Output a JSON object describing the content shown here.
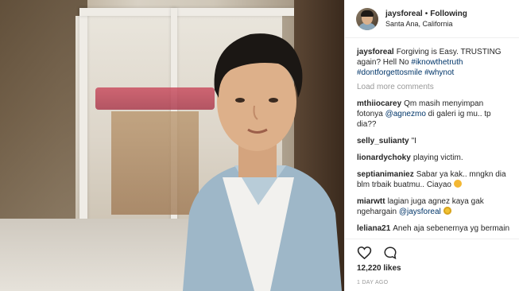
{
  "post": {
    "username": "jaysforeal",
    "separator": "•",
    "follow_status": "Following",
    "location": "Santa Ana, California"
  },
  "caption": {
    "username": "jaysforeal",
    "text": "Forgiving is Easy. TRUSTING again? Hell No",
    "hashtags": [
      "#iknowthetruth",
      "#dontforgettosmile",
      "#whynot"
    ]
  },
  "load_more": "Load more comments",
  "comments": [
    {
      "user": "mthiiocarey",
      "pre": "Qm masih menyimpan fotonya",
      "mention": "@agnezmo",
      "post": "di galeri ig mu.. tp dia??"
    },
    {
      "user": "selly_sulianty",
      "pre": "\"I",
      "mention": "",
      "post": ""
    },
    {
      "user": "lionardychoky",
      "pre": "playing victim.",
      "mention": "",
      "post": ""
    },
    {
      "user": "septianimaniez",
      "pre": "Sabar ya kak.. mngkn dia blm trbaik buatmu.. Ciayao",
      "mention": "",
      "post": ""
    },
    {
      "user": "miarwtt",
      "pre": "lagian juga agnez kaya gak ngehargain",
      "mention": "@jaysforeal",
      "post": ""
    },
    {
      "user": "leliana21",
      "pre": "Aneh aja sebenernya yg bermain api dlu adlh c cwe..... tp yg dibilang playing victim seolah2 vg cwo..... harusnva",
      "mention": "",
      "post": ""
    }
  ],
  "actions": {
    "like_icon": "heart-icon",
    "comment_icon": "comment-icon",
    "likes": "12,220 likes",
    "date": "1 DAY AGO"
  },
  "colors": {
    "link": "#003569",
    "muted": "#999999",
    "border": "#efefef"
  }
}
